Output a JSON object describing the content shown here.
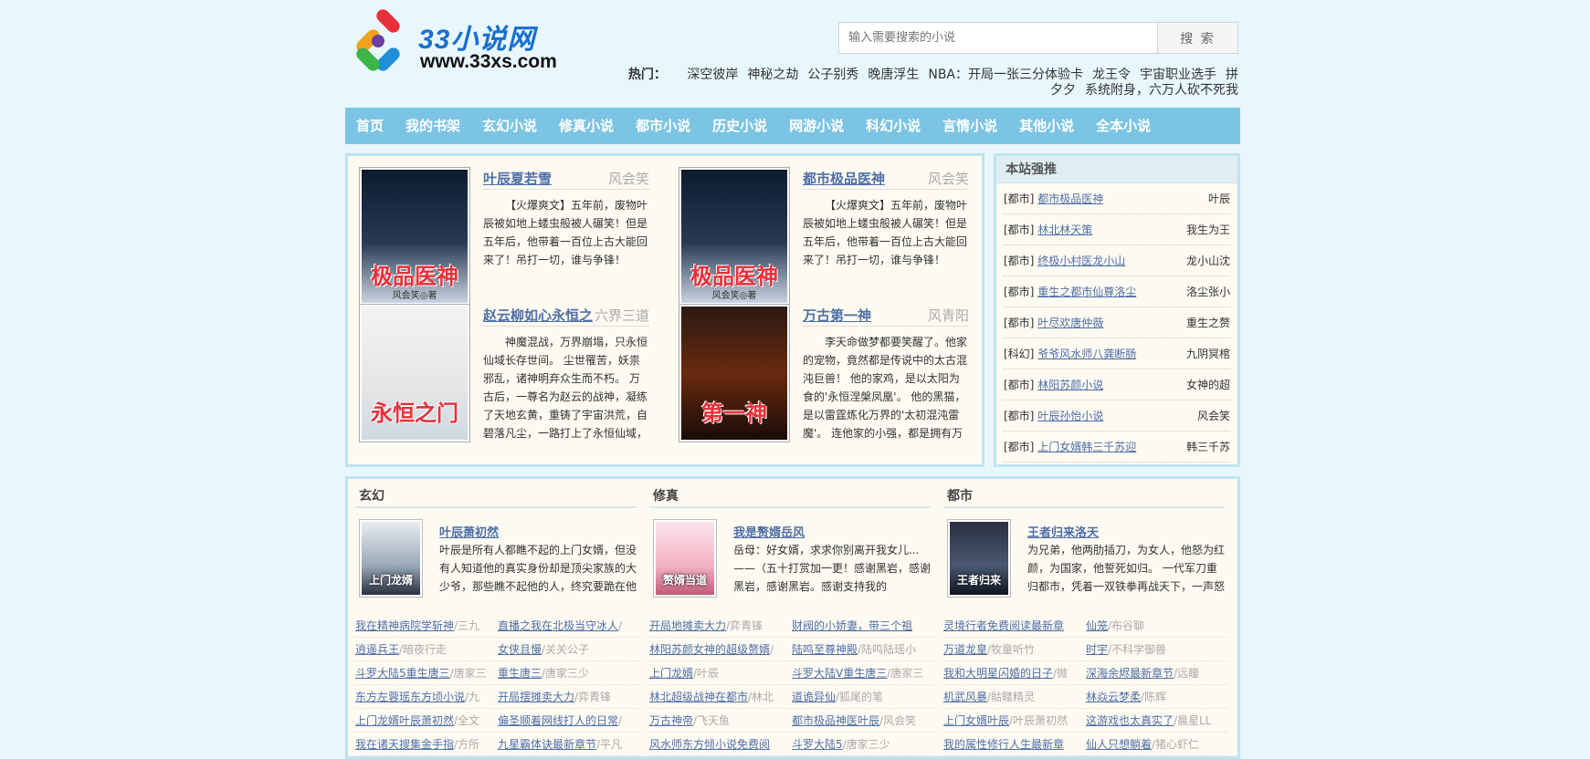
{
  "header": {
    "logo_text": "33小说网",
    "logo_url": "www.33xs.com",
    "search_placeholder": "输入需要搜索的小说",
    "search_button": "搜 索",
    "hot_label": "热门：",
    "hot_links": [
      "深空彼岸",
      "神秘之劫",
      "公子别秀",
      "晚唐浮生",
      "NBA：开局一张三分体验卡",
      "龙王令",
      "宇宙职业选手",
      "拼夕夕",
      "系统附身，六万人砍不死我"
    ]
  },
  "nav": [
    "首页",
    "我的书架",
    "玄幻小说",
    "修真小说",
    "都市小说",
    "历史小说",
    "网游小说",
    "科幻小说",
    "言情小说",
    "其他小说",
    "全本小说"
  ],
  "featured": [
    {
      "title": "叶辰夏若雪",
      "author": "风会笑",
      "desc": "【火爆爽文】五年前，废物叶辰被如地上蝼虫般被人碾笑！但是五年后，他带着一百位上古大能回来了！吊打一切，谁与争锋！",
      "cover_text": "极品医神",
      "cover_author": "风会笑◎著"
    },
    {
      "title": "都市极品医神",
      "author": "风会笑",
      "desc": "【火爆爽文】五年前，废物叶辰被如地上蝼虫般被人碾笑！但是五年后，他带着一百位上古大能回来了！吊打一切，谁与争锋！",
      "cover_text": "极品医神",
      "cover_author": "风会笑◎著"
    },
    {
      "title": "赵云柳如心永恒之",
      "author": "六界三道",
      "desc": "神魔混战，万界崩塌，只永恒仙域长存世间。 尘世罹苦，妖祟邪乱，诸神明弃众生而不朽。 万古后，一尊名为赵云的战神，凝练了天地玄黄，重铸了宇宙洪荒，自碧落凡尘，一路打上了永恒仙域，以",
      "cover_text": "永恒之门",
      "cover_author": ""
    },
    {
      "title": "万古第一神",
      "author": "风青阳",
      "desc": "李天命做梦都要笑醒了。他家的宠物，竟然都是传说中的太古混沌巨兽！ 他的家鸡，是以太阳为食的'永恒涅槃凤凰'。 他的黑猫，是以雷霆炼化万界的'太初混沌雷魔'。 连他家的小强，都是拥有万",
      "cover_text": "第一神",
      "cover_author": ""
    }
  ],
  "rec": {
    "head": "本站强推",
    "items": [
      {
        "cat": "[都市]",
        "name": "都市极品医神",
        "author": "叶辰"
      },
      {
        "cat": "[都市]",
        "name": "林北林天策",
        "author": "我生为王"
      },
      {
        "cat": "[都市]",
        "name": "终极小村医龙小山",
        "author": "龙小山沈"
      },
      {
        "cat": "[都市]",
        "name": "重生之都市仙尊洛尘",
        "author": "洛尘张小"
      },
      {
        "cat": "[都市]",
        "name": "叶尽欢唐仲薇",
        "author": "重生之赘"
      },
      {
        "cat": "[科幻]",
        "name": "爷爷风水师八龚断肠",
        "author": "九阴冥棺"
      },
      {
        "cat": "[都市]",
        "name": "林阳苏颜小说",
        "author": "女神的超"
      },
      {
        "cat": "[都市]",
        "name": "叶辰孙怡小说",
        "author": "风会笑"
      },
      {
        "cat": "[都市]",
        "name": "上门女婿韩三千苏迎",
        "author": "韩三千苏"
      }
    ]
  },
  "cols": [
    {
      "head": "玄幻",
      "cover_text": "上门龙婿",
      "title": "叶辰萧初然",
      "desc": "叶辰是所有人都瞧不起的上门女婿，但没有人知道他的真实身份却是顶尖家族的大少爷，那些瞧不起他的人，终究要跪在他",
      "list": [
        {
          "n": "我在精神病院学斩神",
          "a": "/三九"
        },
        {
          "n": "直播之我在北极当守冰人",
          "a": "/"
        },
        {
          "n": "逍遥兵王",
          "a": "/暗夜行走"
        },
        {
          "n": "女侠且慢",
          "a": "/关关公子"
        },
        {
          "n": "斗罗大陆5重生唐三",
          "a": "/唐家三"
        },
        {
          "n": "重生唐三",
          "a": "/唐家三少"
        },
        {
          "n": "东方左蓉瑶东方顷小说",
          "a": "/九"
        },
        {
          "n": "开局摆摊卖大力",
          "a": "/弈青锋"
        },
        {
          "n": "上门龙婿叶辰萧初然",
          "a": "/全文"
        },
        {
          "n": "偏圣顺着网线打人的日常",
          "a": "/"
        },
        {
          "n": "我在诸天搜集金手指",
          "a": "/方所"
        },
        {
          "n": "九星霸体诀最新章节",
          "a": "/平凡"
        }
      ]
    },
    {
      "head": "修真",
      "cover_text": "赘婿当道",
      "title": "我是赘婿岳风",
      "desc": "岳母：好女婿，求求你别离开我女儿...——（五十打赏加一更！感谢黑岩，感谢黑岩，感谢黑岩。感谢支持我的",
      "list": [
        {
          "n": "开局地摊卖大力",
          "a": "/弈青锋"
        },
        {
          "n": "财阀的小娇妻，带三个祖",
          "a": ""
        },
        {
          "n": "林阳苏颜女神的超级赘婿",
          "a": "/"
        },
        {
          "n": "陆鸣至尊神殿",
          "a": "/陆鸣陆瑶小"
        },
        {
          "n": "上门龙婿",
          "a": "/叶辰"
        },
        {
          "n": "斗罗大陆V重生唐三",
          "a": "/唐家三"
        },
        {
          "n": "林北超级战神在都市",
          "a": "/林北"
        },
        {
          "n": "道诡异仙",
          "a": "/狐尾的笔"
        },
        {
          "n": "万古神帝",
          "a": "/飞天鱼"
        },
        {
          "n": "都市极品神医叶辰",
          "a": "/风会笑"
        },
        {
          "n": "风水师东方倾小说免费阅",
          "a": ""
        },
        {
          "n": "斗罗大陆5",
          "a": "/唐家三少"
        }
      ]
    },
    {
      "head": "都市",
      "cover_text": "王者归来",
      "title": "王者归来洛天",
      "desc": "为兄弟，他两肋插刀，为女人，他怒为红颜，为国家，他誓死如归。 一代军刀重归都市，凭着一双铁拳再战天下，一声怒",
      "list": [
        {
          "n": "灵境行者免费阅读最新章",
          "a": ""
        },
        {
          "n": "仙笼",
          "a": "/布谷聊"
        },
        {
          "n": "万道龙皇",
          "a": "/牧童听竹"
        },
        {
          "n": "时宇",
          "a": "/不科学御兽"
        },
        {
          "n": "我和大明星闪婚的日子",
          "a": "/微"
        },
        {
          "n": "深海余烬最新章节",
          "a": "/远瞳"
        },
        {
          "n": "机武风暴",
          "a": "/骷髅精灵"
        },
        {
          "n": "林焱云梦柔",
          "a": "/陈辉"
        },
        {
          "n": "上门女婿叶辰",
          "a": "/叶辰萧初然"
        },
        {
          "n": "这游戏也太真实了",
          "a": "/晨星LL"
        },
        {
          "n": "我的属性修行人生最新章",
          "a": ""
        },
        {
          "n": "仙人只想躺着",
          "a": "/猪心虾仁"
        }
      ]
    }
  ],
  "colors": {
    "nav_bg": "#7cc4e4",
    "link": "#4f6fa6",
    "border": "#bfe3f1"
  }
}
